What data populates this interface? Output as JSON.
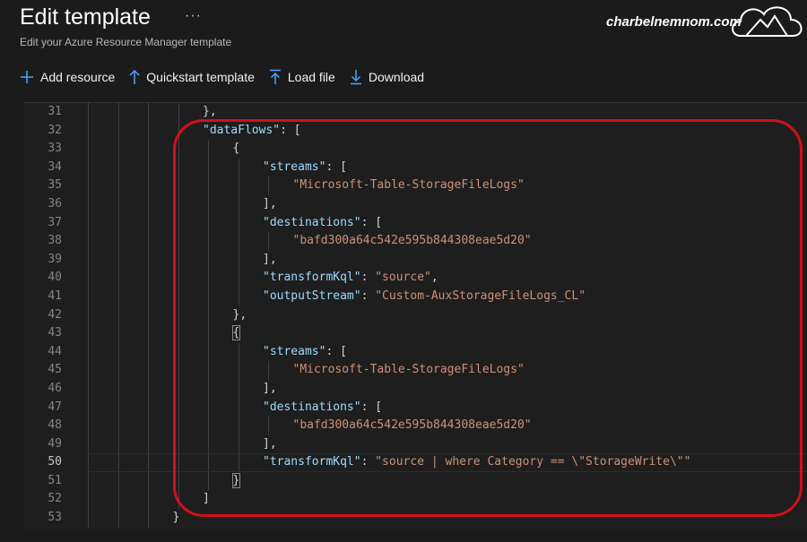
{
  "header": {
    "title": "Edit template",
    "more": "···",
    "subtitle": "Edit your Azure Resource Manager template",
    "watermark": "charbelnemnom.com"
  },
  "toolbar": {
    "add_resource": "Add resource",
    "quickstart": "Quickstart template",
    "load_file": "Load file",
    "download": "Download"
  },
  "icons": {
    "add": "plus-icon",
    "quickstart": "arrow-up-icon",
    "load": "upload-icon",
    "download": "download-icon"
  },
  "colors": {
    "key": "#9cdcfe",
    "string": "#ce9178",
    "punct": "#d4d4d4",
    "annotation": "#d0101a"
  },
  "editor": {
    "active_line": "50",
    "lines": [
      {
        "n": "31",
        "indent": 4,
        "tokens": [
          {
            "t": "p",
            "v": "},"
          }
        ]
      },
      {
        "n": "32",
        "indent": 4,
        "tokens": [
          {
            "t": "k",
            "v": "\"dataFlows\""
          },
          {
            "t": "p",
            "v": ": ["
          }
        ]
      },
      {
        "n": "33",
        "indent": 5,
        "tokens": [
          {
            "t": "p",
            "v": "{"
          }
        ]
      },
      {
        "n": "34",
        "indent": 6,
        "tokens": [
          {
            "t": "k",
            "v": "\"streams\""
          },
          {
            "t": "p",
            "v": ": ["
          }
        ]
      },
      {
        "n": "35",
        "indent": 7,
        "tokens": [
          {
            "t": "s",
            "v": "\"Microsoft-Table-StorageFileLogs\""
          }
        ]
      },
      {
        "n": "36",
        "indent": 6,
        "tokens": [
          {
            "t": "p",
            "v": "],"
          }
        ]
      },
      {
        "n": "37",
        "indent": 6,
        "tokens": [
          {
            "t": "k",
            "v": "\"destinations\""
          },
          {
            "t": "p",
            "v": ": ["
          }
        ]
      },
      {
        "n": "38",
        "indent": 7,
        "tokens": [
          {
            "t": "s",
            "v": "\"bafd300a64c542e595b844308eae5d20\""
          }
        ]
      },
      {
        "n": "39",
        "indent": 6,
        "tokens": [
          {
            "t": "p",
            "v": "],"
          }
        ]
      },
      {
        "n": "40",
        "indent": 6,
        "tokens": [
          {
            "t": "k",
            "v": "\"transformKql\""
          },
          {
            "t": "p",
            "v": ": "
          },
          {
            "t": "s",
            "v": "\"source\""
          },
          {
            "t": "p",
            "v": ","
          }
        ]
      },
      {
        "n": "41",
        "indent": 6,
        "tokens": [
          {
            "t": "k",
            "v": "\"outputStream\""
          },
          {
            "t": "p",
            "v": ": "
          },
          {
            "t": "s",
            "v": "\"Custom-AuxStorageFileLogs_CL\""
          }
        ]
      },
      {
        "n": "42",
        "indent": 5,
        "tokens": [
          {
            "t": "p",
            "v": "},"
          }
        ]
      },
      {
        "n": "43",
        "indent": 5,
        "tokens": [
          {
            "t": "p",
            "v": "{",
            "hl": true
          }
        ]
      },
      {
        "n": "44",
        "indent": 6,
        "tokens": [
          {
            "t": "k",
            "v": "\"streams\""
          },
          {
            "t": "p",
            "v": ": ["
          }
        ]
      },
      {
        "n": "45",
        "indent": 7,
        "tokens": [
          {
            "t": "s",
            "v": "\"Microsoft-Table-StorageFileLogs\""
          }
        ]
      },
      {
        "n": "46",
        "indent": 6,
        "tokens": [
          {
            "t": "p",
            "v": "],"
          }
        ]
      },
      {
        "n": "47",
        "indent": 6,
        "tokens": [
          {
            "t": "k",
            "v": "\"destinations\""
          },
          {
            "t": "p",
            "v": ": ["
          }
        ]
      },
      {
        "n": "48",
        "indent": 7,
        "tokens": [
          {
            "t": "s",
            "v": "\"bafd300a64c542e595b844308eae5d20\""
          }
        ]
      },
      {
        "n": "49",
        "indent": 6,
        "tokens": [
          {
            "t": "p",
            "v": "],"
          }
        ]
      },
      {
        "n": "50",
        "indent": 6,
        "tokens": [
          {
            "t": "k",
            "v": "\"transformKql\""
          },
          {
            "t": "p",
            "v": ": "
          },
          {
            "t": "s",
            "v": "\"source | where Category == \\\"StorageWrite\\\"\""
          }
        ]
      },
      {
        "n": "51",
        "indent": 5,
        "tokens": [
          {
            "t": "p",
            "v": "}",
            "hl": true
          }
        ]
      },
      {
        "n": "52",
        "indent": 4,
        "tokens": [
          {
            "t": "p",
            "v": "]"
          }
        ]
      },
      {
        "n": "53",
        "indent": 3,
        "tokens": [
          {
            "t": "p",
            "v": "}"
          }
        ]
      }
    ]
  }
}
